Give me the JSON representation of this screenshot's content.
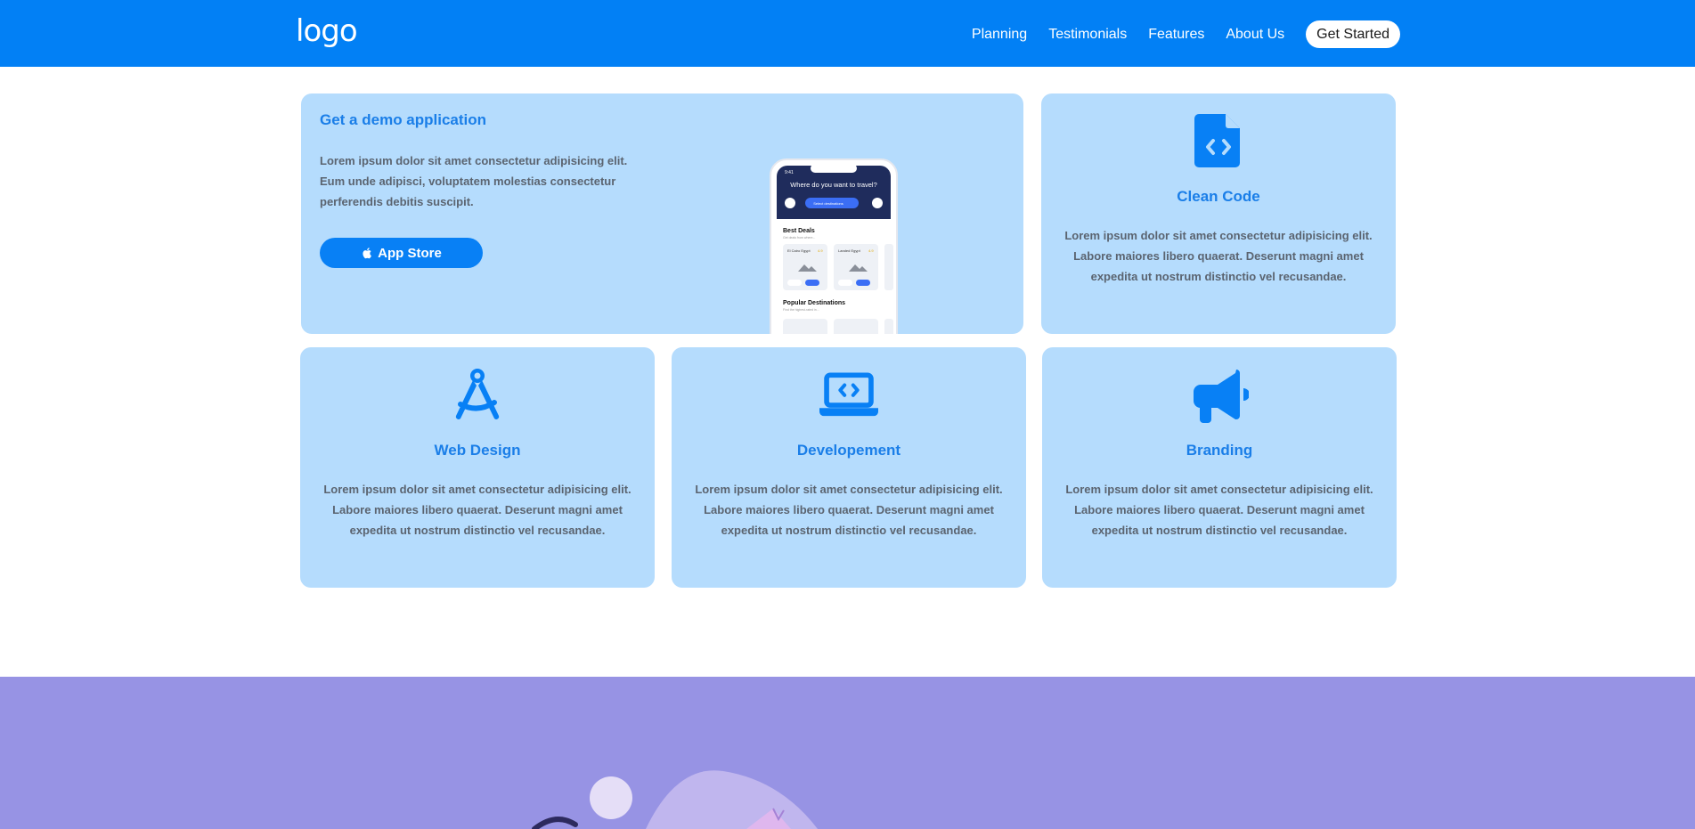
{
  "navbar": {
    "logo": "logo",
    "links": [
      "Planning",
      "Testimonials",
      "Features",
      "About Us"
    ],
    "cta": "Get Started"
  },
  "demo": {
    "title": "Get a demo application",
    "description": "Lorem ipsum dolor sit amet consectetur adipisicing elit. Eum unde adipisci, voluptatem molestias consectetur perferendis debitis suscipit.",
    "button_label": "App Store",
    "phone": {
      "time": "9:41",
      "header": "Where do you want to travel?",
      "select_label": "Select destinations",
      "best_deals": "Best Deals",
      "best_deals_sub": "Get deals from where...",
      "deal1_name": "El Cairo Egypt",
      "deal1_rating": "4.9",
      "deal2_name": "Landed Egypt",
      "deal2_rating": "4.9",
      "popular": "Popular Destinations",
      "popular_sub": "Find the highest-rated in..."
    }
  },
  "features": [
    {
      "title": "Clean Code",
      "icon": "file-code-icon",
      "description": "Lorem ipsum dolor sit amet consectetur adipisicing elit. Labore maiores libero quaerat. Deserunt magni amet expedita ut nostrum distinctio vel recusandae."
    },
    {
      "title": "Web Design",
      "icon": "compass-drafting-icon",
      "description": "Lorem ipsum dolor sit amet consectetur adipisicing elit. Labore maiores libero quaerat. Deserunt magni amet expedita ut nostrum distinctio vel recusandae."
    },
    {
      "title": "Developement",
      "icon": "laptop-code-icon",
      "description": "Lorem ipsum dolor sit amet consectetur adipisicing elit. Labore maiores libero quaerat. Deserunt magni amet expedita ut nostrum distinctio vel recusandae."
    },
    {
      "title": "Branding",
      "icon": "bullhorn-icon",
      "description": "Lorem ipsum dolor sit amet consectetur adipisicing elit. Labore maiores libero quaerat. Deserunt magni amet expedita ut nostrum distinctio vel recusandae."
    }
  ],
  "colors": {
    "nav": "#0280f5",
    "card": "#b5dcfd",
    "accent": "#1a7ee8",
    "purple": "#9793e4"
  }
}
